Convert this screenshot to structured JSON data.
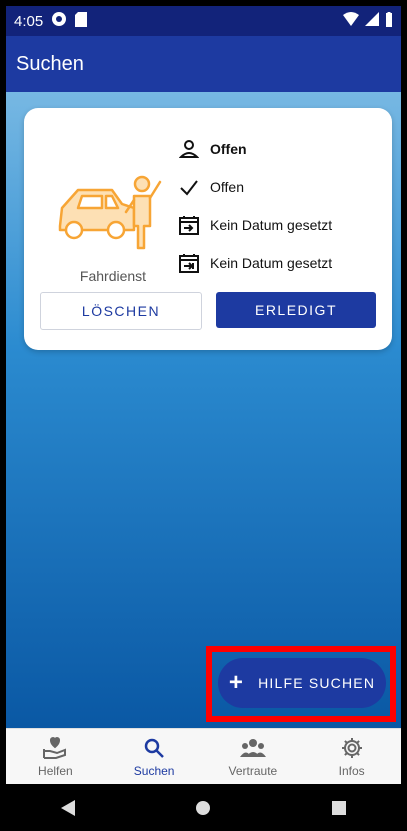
{
  "status_bar": {
    "time": "4:05"
  },
  "app_bar": {
    "title": "Suchen"
  },
  "card": {
    "category": "Fahrdienst",
    "info_rows": [
      {
        "icon": "person-icon",
        "text": "Offen"
      },
      {
        "icon": "check-icon",
        "text": "Offen"
      },
      {
        "icon": "calendar-start-icon",
        "text": "Kein Datum gesetzt"
      },
      {
        "icon": "calendar-end-icon",
        "text": "Kein Datum gesetzt"
      }
    ],
    "delete_label": "LÖSCHEN",
    "done_label": "ERLEDIGT"
  },
  "fab": {
    "label": "HILFE SUCHEN"
  },
  "bottom_nav": {
    "items": [
      {
        "label": "Helfen",
        "icon": "heart-hand-icon"
      },
      {
        "label": "Suchen",
        "icon": "search-icon"
      },
      {
        "label": "Vertraute",
        "icon": "group-icon"
      },
      {
        "label": "Infos",
        "icon": "gear-icon"
      }
    ]
  },
  "colors": {
    "primary": "#1d3aa1",
    "accent_orange": "#f7a535",
    "highlight_red": "#ff0000"
  }
}
